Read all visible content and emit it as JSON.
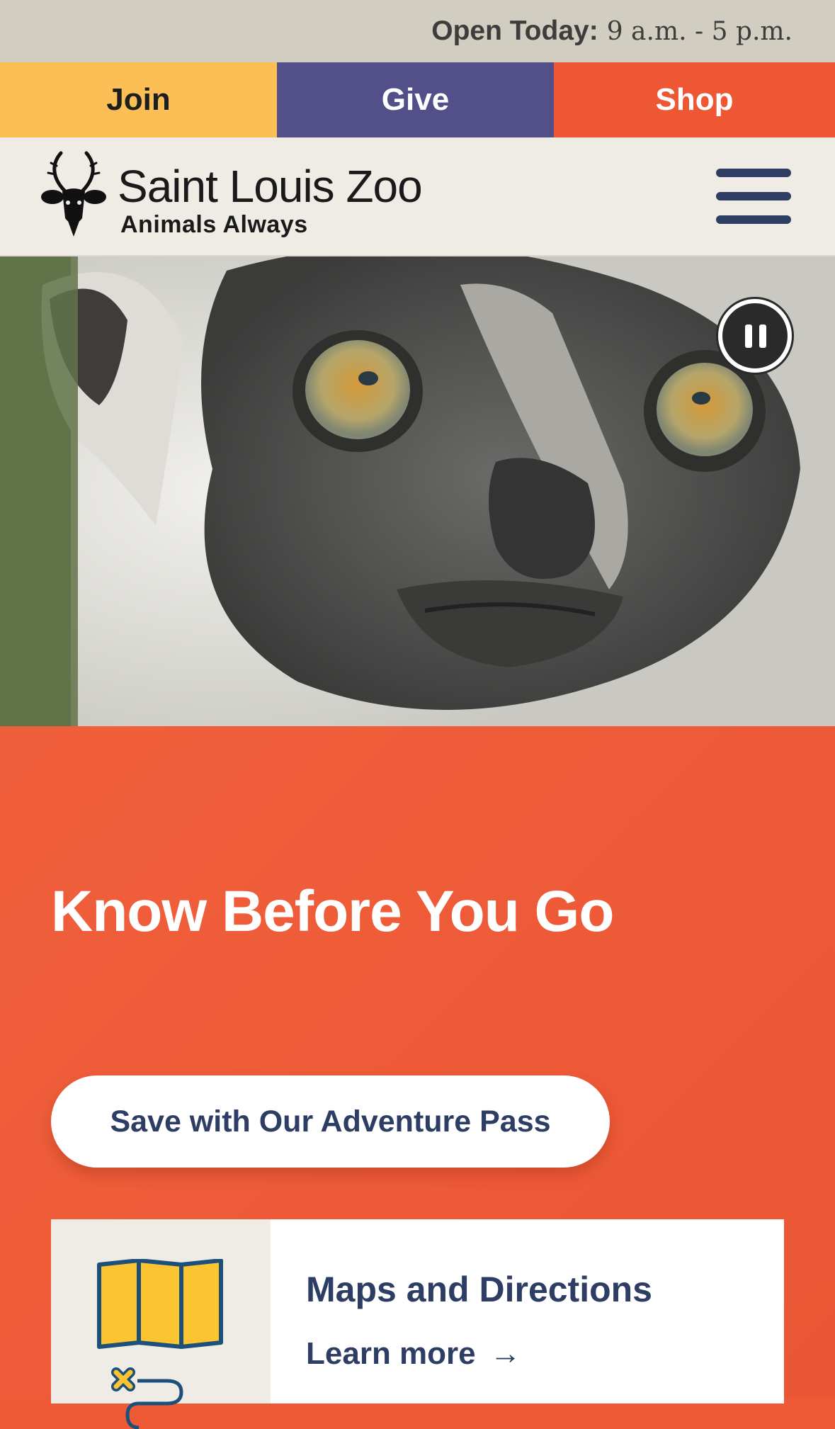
{
  "topbar": {
    "hours_label": "Open Today:",
    "hours_value": "9 a.m. - 5 p.m."
  },
  "actions": {
    "join": "Join",
    "give": "Give",
    "shop": "Shop"
  },
  "header": {
    "logo_name": "Saint Louis Zoo",
    "logo_tagline": "Animals Always",
    "menu_icon": "hamburger-menu-icon"
  },
  "hero": {
    "subject": "lemur",
    "control_icon": "pause-icon"
  },
  "promo": {
    "title": "Know Before You Go",
    "cta_label": "Save with Our Adventure Pass"
  },
  "card": {
    "icon": "map-icon",
    "title": "Maps and Directions",
    "link_label": "Learn more",
    "link_arrow": "→"
  },
  "colors": {
    "topbar_bg": "#d1cdc0",
    "join_bg": "#fcbf56",
    "give_bg": "#534f89",
    "shop_bg": "#ee5733",
    "header_bg": "#efece5",
    "navy": "#2e3d63",
    "promo_bg": "#ee5a36"
  }
}
